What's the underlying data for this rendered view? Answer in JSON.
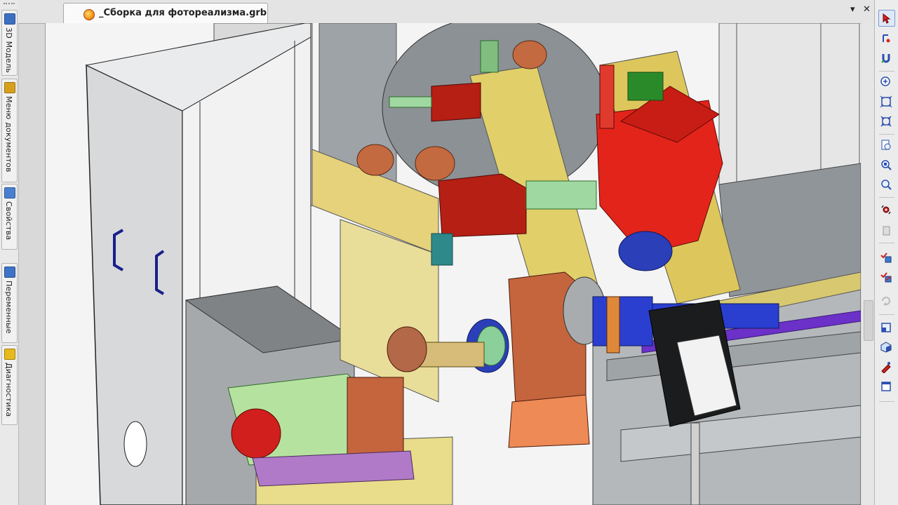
{
  "document": {
    "tab_title": "_Сборка для фотореализма.grb"
  },
  "left_panel": {
    "tabs": [
      {
        "label": "3D Модель",
        "icon": "model-tree-icon",
        "color": "#3c6fc1"
      },
      {
        "label": "Меню документов",
        "icon": "document-menu-icon",
        "color": "#d6a01e"
      },
      {
        "label": "Свойства",
        "icon": "properties-icon",
        "color": "#4a7fcf"
      },
      {
        "label": "Переменные",
        "icon": "variables-icon",
        "color": "#3e73c6"
      },
      {
        "label": "Диагностика",
        "icon": "diagnostics-icon",
        "color": "#e6b91d"
      }
    ]
  },
  "window_controls": {
    "menu_glyph": "▾",
    "close_glyph": "✕"
  },
  "right_toolbar": {
    "tools": [
      "select-icon",
      "snap-icon",
      "magnet-icon",
      "zoom-in-icon",
      "fit-window-icon",
      "zoom-extents-icon",
      "zoom-page-icon",
      "zoom-window-icon",
      "zoom-out-icon",
      "rotate-icon",
      "copy-view-icon",
      "visibility-icon",
      "visibility-toggle-icon",
      "refresh-icon",
      "view-cube-icon",
      "shaded-cube-icon",
      "render-icon",
      "frame-icon"
    ]
  }
}
